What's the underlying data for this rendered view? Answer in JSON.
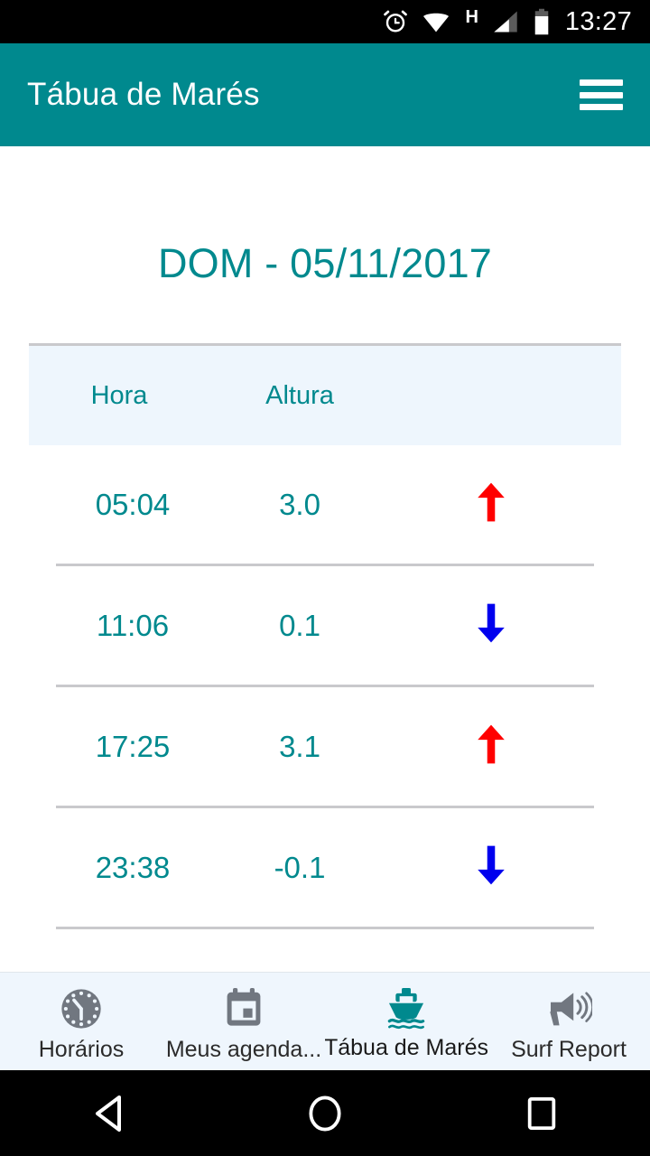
{
  "status_bar": {
    "alarm_icon": "alarm-icon",
    "wifi_icon": "wifi-icon",
    "network_type": "H",
    "signal_icon": "signal-icon",
    "battery_icon": "battery-icon",
    "time": "13:27"
  },
  "app_bar": {
    "title": "Tábua de Marés",
    "menu_icon": "hamburger-menu-icon",
    "background_color": "#00898e"
  },
  "main": {
    "date_heading": "DOM - 05/11/2017",
    "table": {
      "columns": [
        "Hora",
        "Altura",
        ""
      ],
      "rows": [
        {
          "hora": "05:04",
          "altura": "3.0",
          "direction": "up",
          "arrow_color": "#ff0000"
        },
        {
          "hora": "11:06",
          "altura": "0.1",
          "direction": "down",
          "arrow_color": "#0000ee"
        },
        {
          "hora": "17:25",
          "altura": "3.1",
          "direction": "up",
          "arrow_color": "#ff0000"
        },
        {
          "hora": "23:38",
          "altura": "-0.1",
          "direction": "down",
          "arrow_color": "#0000ee"
        }
      ],
      "header_background": "#eef6fd",
      "text_color": "#00898e"
    }
  },
  "bottom_nav": {
    "items": [
      {
        "label": "Horários",
        "icon": "clock-icon",
        "active": false
      },
      {
        "label": "Meus agenda...",
        "icon": "calendar-icon",
        "active": false
      },
      {
        "label": "Tábua de Marés",
        "icon": "boat-icon",
        "active": true
      },
      {
        "label": "Surf Report",
        "icon": "megaphone-icon",
        "active": false
      }
    ],
    "active_color": "#00898e",
    "inactive_color": "#717780"
  },
  "android_nav": {
    "back": "back-triangle-icon",
    "home": "home-circle-icon",
    "recents": "recents-square-icon"
  }
}
